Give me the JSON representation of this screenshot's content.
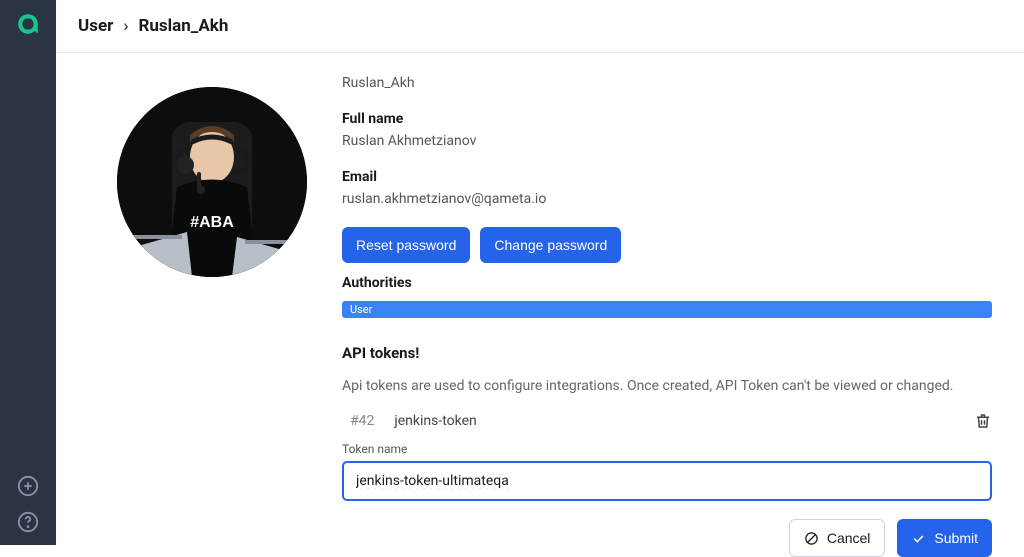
{
  "breadcrumb": {
    "root": "User",
    "current": "Ruslan_Akh"
  },
  "profile": {
    "username": "Ruslan_Akh",
    "fullname_label": "Full name",
    "fullname_value": "Ruslan Akhmetzianov",
    "email_label": "Email",
    "email_value": "ruslan.akhmetzianov@qameta.io"
  },
  "buttons": {
    "reset_password": "Reset password",
    "change_password": "Change password",
    "cancel": "Cancel",
    "submit": "Submit"
  },
  "authorities": {
    "label": "Authorities",
    "badge": "User"
  },
  "tokens": {
    "title": "API tokens!",
    "description": "Api tokens are used to configure integrations. Once created, API Token can't be viewed or changed.",
    "items": [
      {
        "id": "#42",
        "name": "jenkins-token"
      }
    ],
    "field_label": "Token name",
    "field_value": "jenkins-token-ultimateqa"
  },
  "colors": {
    "primary": "#2563eb",
    "sidebar_bg": "#2b3445",
    "logo_accent": "#17c68b"
  }
}
